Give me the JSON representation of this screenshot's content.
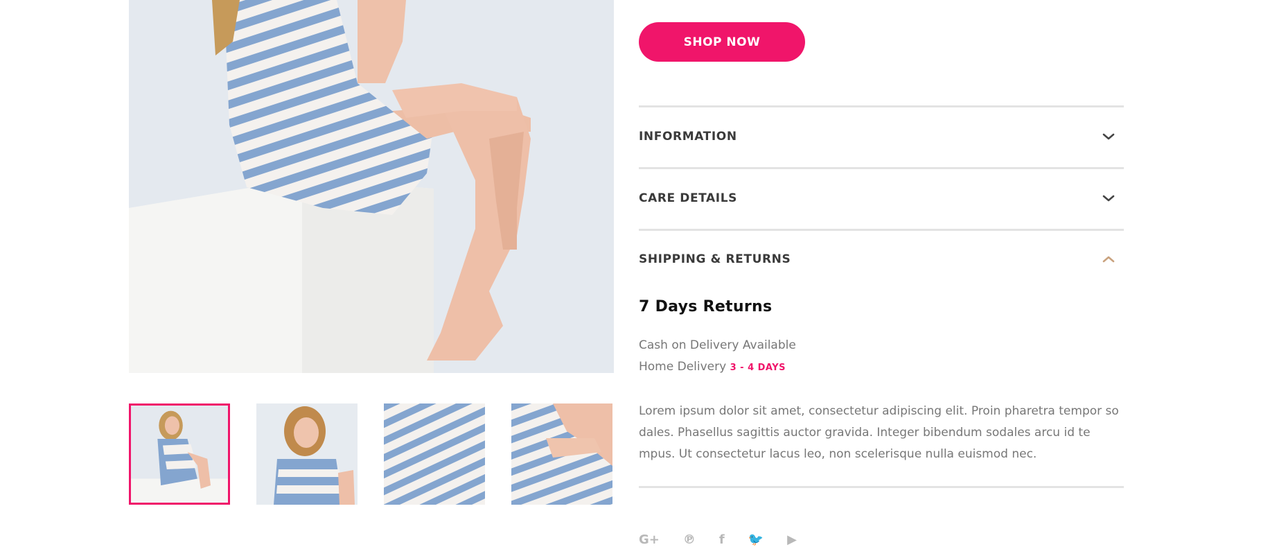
{
  "product": {
    "main_image_alt": "woman in blue striped shirt dress sitting on white cube",
    "thumbnails": [
      {
        "name": "thumb-1",
        "active": true
      },
      {
        "name": "thumb-2",
        "active": false
      },
      {
        "name": "thumb-3",
        "active": false
      },
      {
        "name": "thumb-4",
        "active": false
      }
    ]
  },
  "cta": {
    "shop_now_label": "SHOP NOW"
  },
  "accordion": {
    "information": {
      "title": "INFORMATION",
      "expanded": false
    },
    "care_details": {
      "title": "CARE DETAILS",
      "expanded": false
    },
    "shipping": {
      "title": "SHIPPING & RETURNS",
      "expanded": true,
      "heading": "7 Days Returns",
      "cod": "Cash on Delivery Available",
      "home_delivery": "Home Delivery",
      "delivery_days": "3 - 4 DAYS",
      "description": "Lorem ipsum dolor sit amet, consectetur adipiscing elit. Proin pharetra tempor so dales. Phasellus sagittis auctor gravida. Integer bibendum sodales arcu id te mpus. Ut consectetur lacus leo, non scelerisque nulla euismod nec."
    }
  },
  "social": [
    {
      "icon": "google-plus-icon",
      "glyph": "G+"
    },
    {
      "icon": "pinterest-icon",
      "glyph": "℗"
    },
    {
      "icon": "facebook-icon",
      "glyph": "f"
    },
    {
      "icon": "twitter-icon",
      "glyph": "🐦"
    },
    {
      "icon": "youtube-icon",
      "glyph": "▶"
    }
  ],
  "colors": {
    "accent": "#f0156a",
    "divider": "#e3e3e3",
    "chevron_active": "#c9a27e"
  }
}
